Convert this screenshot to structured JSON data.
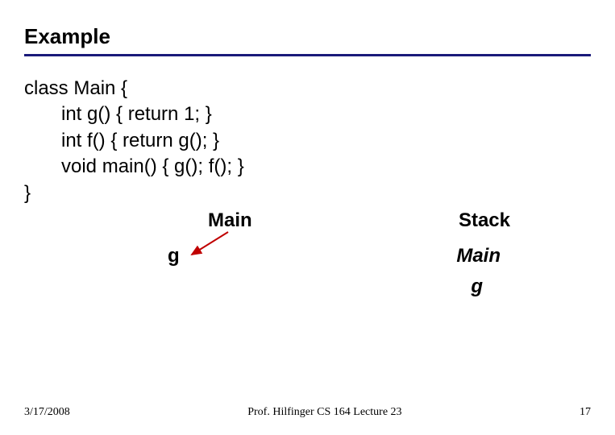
{
  "title": "Example",
  "code": {
    "line1": "class Main {",
    "line2": "int g() { return 1; }",
    "line3": "int f() { return g(); }",
    "line4": "void main() { g(); f(); }",
    "line5": "}"
  },
  "diagram": {
    "main_label": "Main",
    "g_label": "g",
    "stack_header": "Stack",
    "stack_items": [
      "Main",
      "g"
    ]
  },
  "footer": {
    "date": "3/17/2008",
    "center": "Prof. Hilfinger  CS 164  Lecture 23",
    "page": "17"
  }
}
